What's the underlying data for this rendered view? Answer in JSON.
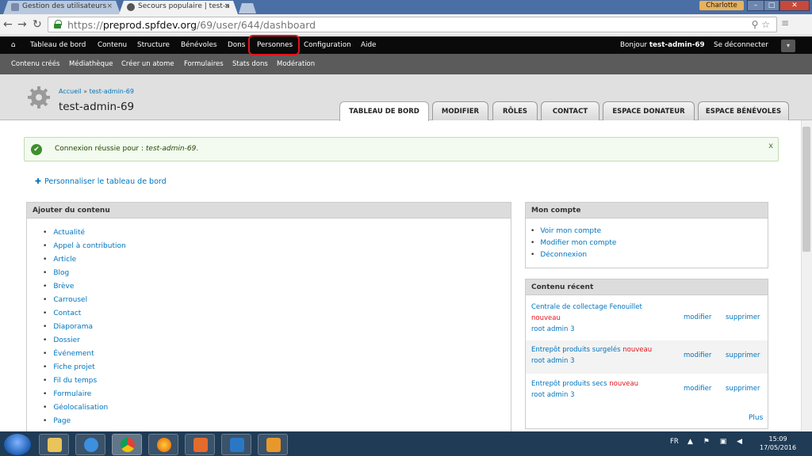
{
  "browser": {
    "tabs": [
      {
        "title": "Gestion des utilisateurs",
        "active": false
      },
      {
        "title": "Secours populaire | test-a",
        "active": true
      }
    ],
    "user_chip": "Charlotte",
    "url_host": "preprod.spfdev.org",
    "url_path": "/69/user/644/dashboard",
    "url_scheme": "https://"
  },
  "admin_menu": {
    "items": [
      "Tableau de bord",
      "Contenu",
      "Structure",
      "Bénévoles",
      "Dons",
      "Personnes",
      "Configuration",
      "Aide"
    ],
    "greeting_prefix": "Bonjour",
    "greeting_user": "test-admin-69",
    "logout": "Se déconnecter"
  },
  "shortcuts": [
    "Contenu créés",
    "Médiathèque",
    "Créer un atome",
    "Formulaires",
    "Stats dons",
    "Modération"
  ],
  "header": {
    "breadcrumb": [
      "Accueil",
      "test-admin-69"
    ],
    "title": "test-admin-69",
    "tabs": [
      "TABLEAU DE BORD",
      "MODIFIER",
      "RÔLES",
      "CONTACT",
      "ESPACE DONATEUR",
      "ESPACE BÉNÉVOLES"
    ],
    "active_tab": "TABLEAU DE BORD"
  },
  "message": {
    "text": "Connexion réussie pour : ",
    "user": "test-admin-69",
    "suffix": ".",
    "close": "x"
  },
  "customize_link": "Personnaliser le tableau de bord",
  "add_content": {
    "title": "Ajouter du contenu",
    "items": [
      "Actualité",
      "Appel à contribution",
      "Article",
      "Blog",
      "Brève",
      "Carrousel",
      "Contact",
      "Diaporama",
      "Dossier",
      "Événement",
      "Fiche projet",
      "Fil du temps",
      "Formulaire",
      "Géolocalisation",
      "Page"
    ]
  },
  "account": {
    "title": "Mon compte",
    "items": [
      "Voir mon compte",
      "Modifier mon compte",
      "Déconnexion"
    ]
  },
  "recent": {
    "title": "Contenu récent",
    "rows": [
      {
        "title": "Centrale de collectage Fenouillet",
        "badge": "nouveau",
        "author": "root admin 3",
        "edit": "modifier",
        "delete": "supprimer"
      },
      {
        "title": "Entrepôt produits surgelés",
        "badge": "nouveau",
        "author": "root admin 3",
        "edit": "modifier",
        "delete": "supprimer"
      },
      {
        "title": "Entrepôt produits secs",
        "badge": "nouveau",
        "author": "root admin 3",
        "edit": "modifier",
        "delete": "supprimer"
      }
    ],
    "more": "Plus"
  },
  "taskbar": {
    "lang": "FR",
    "time": "15:09",
    "date": "17/05/2016"
  },
  "colors": {
    "link": "#0074bd",
    "highlight_box": "#e0141c",
    "admin_bar": "#0a0a0a",
    "shortcut_bar": "#5b5b5b"
  }
}
